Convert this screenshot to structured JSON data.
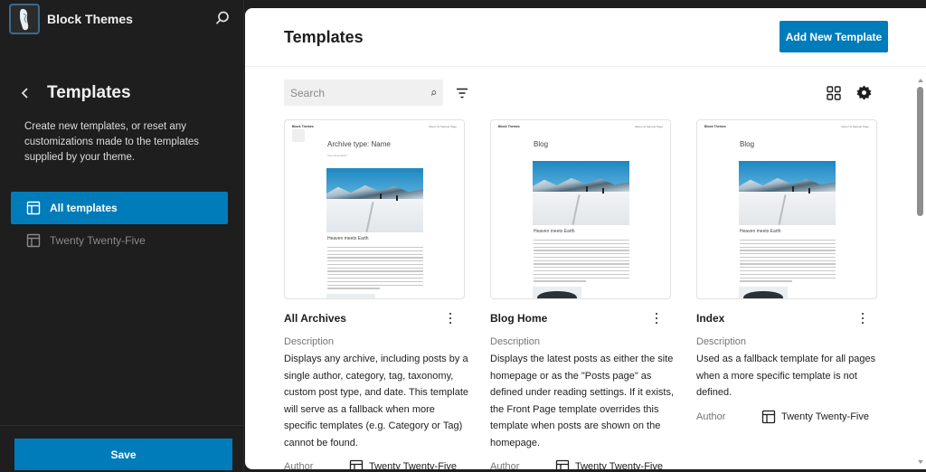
{
  "sidebar": {
    "site_title": "Block Themes",
    "nav_title": "Templates",
    "description": "Create new templates, or reset any customizations made to the templates supplied by your theme.",
    "items": [
      {
        "label": "All templates",
        "icon": "layout-icon",
        "active": true
      },
      {
        "label": "Twenty Twenty-Five",
        "icon": "layout-icon",
        "active": false
      }
    ],
    "save_label": "Save"
  },
  "main": {
    "title": "Templates",
    "add_button_label": "Add New Template",
    "search": {
      "placeholder": "Search",
      "value": ""
    },
    "fields": {
      "description_label": "Description",
      "author_label": "Author"
    },
    "cards": [
      {
        "title": "All Archives",
        "description": "Displays any archive, including posts by a single author, category, tag, taxonomy, custom post type, and date. This template will serve as a fallback when more specific templates (e.g. Category or Tag) cannot be found.",
        "author": "Twenty Twenty-Five",
        "preview": {
          "site": "Block Themes",
          "nav": "About Us   Sample Page",
          "heading": "Archive type: Name",
          "subheading": "Term description",
          "post_title": "Heaven meets Earth"
        }
      },
      {
        "title": "Blog Home",
        "description": "Displays the latest posts as either the site homepage or as the \"Posts page\" as defined under reading settings. If it exists, the Front Page template overrides this template when posts are shown on the homepage.",
        "author": "Twenty Twenty-Five",
        "preview": {
          "site": "Block Themes",
          "nav": "About Us   Sample Page",
          "heading": "Blog",
          "subheading": "",
          "post_title": "Heaven meets Earth"
        }
      },
      {
        "title": "Index",
        "description": "Used as a fallback template for all pages when a more specific template is not defined.",
        "author": "Twenty Twenty-Five",
        "preview": {
          "site": "Block Themes",
          "nav": "About Us   Sample Page",
          "heading": "Blog",
          "subheading": "",
          "post_title": "Heaven meets Earth"
        }
      }
    ]
  },
  "colors": {
    "accent": "#007cba",
    "sidebar_bg": "#1e1e1e",
    "main_bg": "#ffffff"
  }
}
